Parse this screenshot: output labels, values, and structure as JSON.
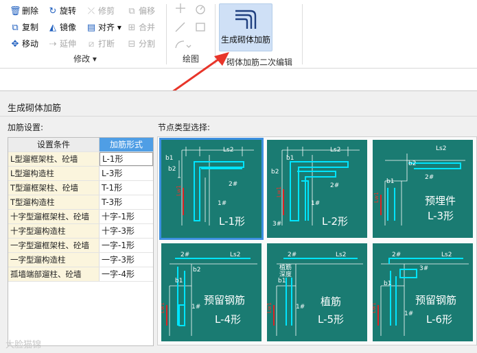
{
  "ribbon": {
    "modify": {
      "label": "修改 ▾",
      "items": [
        {
          "label": "删除",
          "icon": "trash-icon",
          "glyph": "🗑",
          "enabled": true
        },
        {
          "label": "旋转",
          "icon": "rotate-icon",
          "glyph": "↻",
          "enabled": true
        },
        {
          "label": "修剪",
          "icon": "trim-icon",
          "glyph": "-/-",
          "enabled": false
        },
        {
          "label": "偏移",
          "icon": "offset-icon",
          "glyph": "⧉",
          "enabled": false
        },
        {
          "label": "复制",
          "icon": "copy-icon",
          "glyph": "⧉",
          "enabled": true
        },
        {
          "label": "镜像",
          "icon": "mirror-icon",
          "glyph": "⊿",
          "enabled": true
        },
        {
          "label": "对齐 ▾",
          "icon": "align-icon",
          "glyph": "▭",
          "enabled": true
        },
        {
          "label": "合并",
          "icon": "merge-icon",
          "glyph": "⊞",
          "enabled": false
        },
        {
          "label": "移动",
          "icon": "move-icon",
          "glyph": "✥",
          "enabled": true
        },
        {
          "label": "延伸",
          "icon": "extend-icon",
          "glyph": "→",
          "enabled": false
        },
        {
          "label": "打断",
          "icon": "break-icon",
          "glyph": "⧄",
          "enabled": false
        },
        {
          "label": "分割",
          "icon": "split-icon",
          "glyph": "⊟",
          "enabled": false
        }
      ]
    },
    "draw": {
      "label": "绘图"
    },
    "big_button": {
      "label": "生成砌体加筋",
      "group_label": "砌体加筋二次编辑"
    }
  },
  "dialog": {
    "title": "生成砌体加筋",
    "settings_label": "加筋设置:",
    "node_label": "节点类型选择:",
    "table": {
      "headers": [
        "设置条件",
        "加筋形式"
      ],
      "rows": [
        {
          "cond": "L型遛框架柱、砼墙",
          "form": "L-1形"
        },
        {
          "cond": "L型遛构造柱",
          "form": "L-3形"
        },
        {
          "cond": "T型遛框架柱、砼墙",
          "form": "T-1形"
        },
        {
          "cond": "T型遛构造柱",
          "form": "T-3形"
        },
        {
          "cond": "十字型遛框架柱、砼墙",
          "form": "十字-1形"
        },
        {
          "cond": "十字型遛构造柱",
          "form": "十字-3形"
        },
        {
          "cond": "一字型遛框架柱、砼墙",
          "form": "一字-1形"
        },
        {
          "cond": "一字型遛构造柱",
          "form": "一字-3形"
        },
        {
          "cond": "孤墙端部遛柱、砼墙",
          "form": "一字-4形"
        }
      ]
    },
    "nodes": [
      {
        "caption": "L-1形",
        "tags": [
          "b1",
          "Ls2",
          "b2",
          "2#",
          "1#",
          "Lw1"
        ]
      },
      {
        "caption": "L-2形",
        "tags": [
          "b1",
          "Ls2",
          "b2",
          "2#",
          "1#",
          "3#",
          "Lw1"
        ]
      },
      {
        "caption": "L-3形",
        "sub": "预埋件",
        "tags": [
          "Ls2",
          "b2",
          "2#",
          "b1",
          "Lw1"
        ]
      },
      {
        "caption": "L-4形",
        "sub": "预留钢筋",
        "tags": [
          "2#",
          "Ls2",
          "b2",
          "b1",
          "1#",
          "Lw1"
        ]
      },
      {
        "caption": "L-5形",
        "sub": "植筋",
        "tags": [
          "2#",
          "Ls2",
          "植筋",
          "深度",
          "b1",
          "1#",
          "Lw1"
        ]
      },
      {
        "caption": "L-6形",
        "sub": "预留钢筋",
        "tags": [
          "2#",
          "Ls2",
          "3#",
          "b1",
          "1#",
          "Lw1"
        ]
      }
    ]
  },
  "watermark": "大脸猫锦",
  "colors": {
    "accent": "#4f9ee5",
    "node_bg": "#1a7b72",
    "arrow": "#e8352a"
  }
}
